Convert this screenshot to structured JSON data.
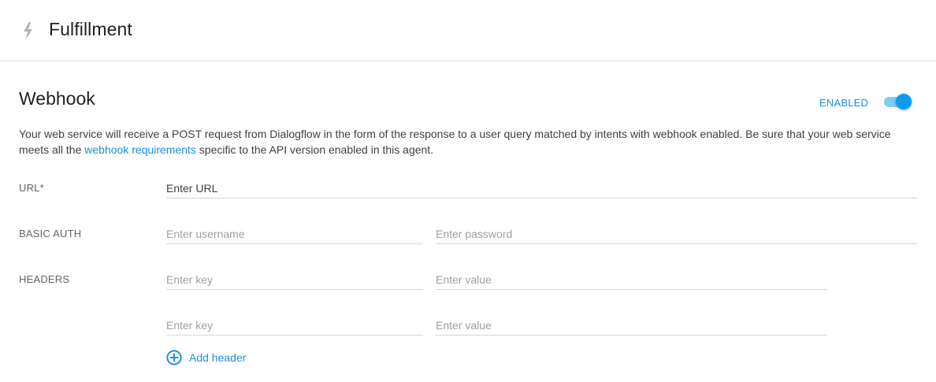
{
  "header": {
    "title": "Fulfillment",
    "icon": "bolt-icon"
  },
  "webhook": {
    "title": "Webhook",
    "toggle_label": "ENABLED",
    "enabled": true,
    "description_before": "Your web service will receive a POST request from Dialogflow in the form of the response to a user query matched by intents with webhook enabled. Be sure that your web service meets all the ",
    "description_link": "webhook requirements",
    "description_after": " specific to the API version enabled in this agent.",
    "url": {
      "label": "URL*",
      "placeholder": "Enter URL",
      "value": ""
    },
    "basic_auth": {
      "label": "BASIC AUTH",
      "username_placeholder": "Enter username",
      "password_placeholder": "Enter password"
    },
    "headers": {
      "label": "HEADERS",
      "rows": [
        {
          "key_placeholder": "Enter key",
          "value_placeholder": "Enter value"
        },
        {
          "key_placeholder": "Enter key",
          "value_placeholder": "Enter value"
        }
      ],
      "add_label": "Add header"
    }
  },
  "colors": {
    "accent": "#1a8fd8",
    "toggle_knob": "#0d9bf0",
    "toggle_track": "#7fcdf4",
    "label": "#5f6368",
    "divider": "#e0e0e0"
  }
}
